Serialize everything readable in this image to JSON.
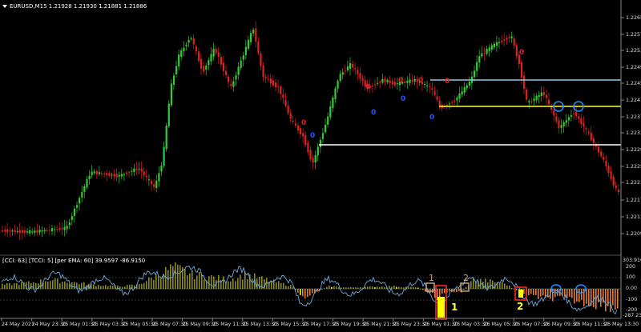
{
  "symbol_header": "EURUSD,M15  1.21928 1.21930 1.21881 1.21886",
  "indicator_header": "[CCI: 63] [TCCI: 5] [per EMA: 60]  39.9597 -86.9150",
  "price_axis": [
    "1.22655",
    "1.22575",
    "1.22535",
    "1.22495",
    "1.22455",
    "1.22415",
    "1.22375",
    "1.22335",
    "1.22295",
    "1.22255",
    "1.22215",
    "1.22175",
    "1.22135",
    "1.22095"
  ],
  "indicator_axis": {
    "top": "303.9166",
    "levels": [
      "200",
      "100",
      "0.00",
      "-100",
      "-200"
    ],
    "bottom": "-287.2378"
  },
  "time_axis": [
    "24 May 2021",
    "24 May 23:30",
    "25 May 01:30",
    "25 May 03:30",
    "25 May 05:30",
    "25 May 07:30",
    "25 May 09:30",
    "25 May 11:30",
    "25 May 13:30",
    "25 May 15:30",
    "25 May 17:30",
    "25 May 19:30",
    "25 May 21:30",
    "25 May 23:30",
    "26 May 01:30",
    "26 May 03:30",
    "26 May 05:30",
    "26 May 07:30",
    "26 May 09:30",
    "26 May 11:30",
    "26 May 13:30"
  ],
  "annotations": {
    "sq1": "1",
    "sq2": "2",
    "bar1": "1",
    "bar2": "2"
  },
  "fractal_labels": {
    "up": "0",
    "down": "0"
  },
  "colors": {
    "bull": "#33cc33",
    "bear": "#dd2222",
    "hline_blue": "#87ceeb",
    "hline_yellow": "#ffff33",
    "hline_white": "#ffffff",
    "ring": "#1e90ff",
    "cci_olive": "#8a8a2a",
    "cci_orange": "#e07b39",
    "cci_line": "#6fa8dc"
  }
}
